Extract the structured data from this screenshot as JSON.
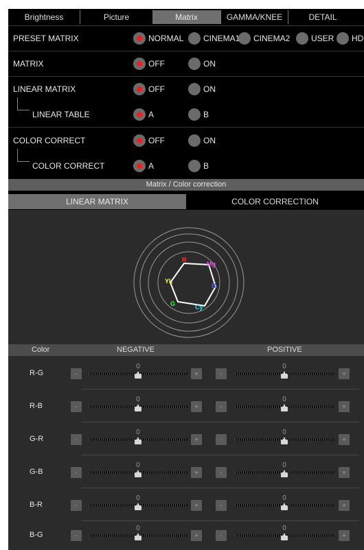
{
  "tabs": [
    {
      "label": "Brightness",
      "active": false
    },
    {
      "label": "Picture",
      "active": false
    },
    {
      "label": "Matrix",
      "active": true
    },
    {
      "label": "GAMMA/KNEE",
      "active": false
    },
    {
      "label": "DETAIL",
      "active": false
    }
  ],
  "settings": {
    "preset_matrix": {
      "label": "PRESET MATRIX",
      "options": [
        {
          "label": "NORMAL",
          "selected": true
        },
        {
          "label": "CINEMA1",
          "selected": false
        },
        {
          "label": "CINEMA2",
          "selected": false
        },
        {
          "label": "USER",
          "selected": false
        },
        {
          "label": "HD",
          "selected": false
        }
      ]
    },
    "matrix": {
      "label": "MATRIX",
      "options": [
        {
          "label": "OFF",
          "selected": true
        },
        {
          "label": "ON",
          "selected": false
        }
      ]
    },
    "linear_matrix": {
      "label": "LINEAR MATRIX",
      "options": [
        {
          "label": "OFF",
          "selected": true
        },
        {
          "label": "ON",
          "selected": false
        }
      ]
    },
    "linear_table": {
      "label": "LINEAR TABLE",
      "options": [
        {
          "label": "A",
          "selected": true
        },
        {
          "label": "B",
          "selected": false
        }
      ]
    },
    "color_correct": {
      "label": "COLOR CORRECT",
      "options": [
        {
          "label": "OFF",
          "selected": true
        },
        {
          "label": "ON",
          "selected": false
        }
      ]
    },
    "color_correct_table": {
      "label": "COLOR CORRECT",
      "options": [
        {
          "label": "A",
          "selected": true
        },
        {
          "label": "B",
          "selected": false
        }
      ]
    }
  },
  "section_title": "Matrix / Color correction",
  "subtabs": [
    {
      "label": "LINEAR MATRIX",
      "active": true
    },
    {
      "label": "COLOR CORRECTION",
      "active": false
    }
  ],
  "vectorscope": {
    "labels": [
      {
        "text": "R",
        "color": "#ff3030"
      },
      {
        "text": "Mg",
        "color": "#ff40ff"
      },
      {
        "text": "B",
        "color": "#4060ff"
      },
      {
        "text": "Cy",
        "color": "#30e0ff"
      },
      {
        "text": "G",
        "color": "#30ff40"
      },
      {
        "text": "YL",
        "color": "#ffff40"
      }
    ]
  },
  "adjust": {
    "col_color": "Color",
    "col_negative": "NEGATIVE",
    "col_positive": "POSITIVE",
    "minus_label": "-",
    "plus_label": "+",
    "rows": [
      {
        "name": "R-G",
        "negative": "0",
        "positive": "0"
      },
      {
        "name": "R-B",
        "negative": "0",
        "positive": "0"
      },
      {
        "name": "G-R",
        "negative": "0",
        "positive": "0"
      },
      {
        "name": "G-B",
        "negative": "0",
        "positive": "0"
      },
      {
        "name": "B-R",
        "negative": "0",
        "positive": "0"
      },
      {
        "name": "B-G",
        "negative": "0",
        "positive": "0"
      }
    ]
  },
  "colors": {
    "accent_red": "#f21f1f",
    "panel_bg": "#2b2b2b",
    "active_tab": "#6f6f6f"
  }
}
